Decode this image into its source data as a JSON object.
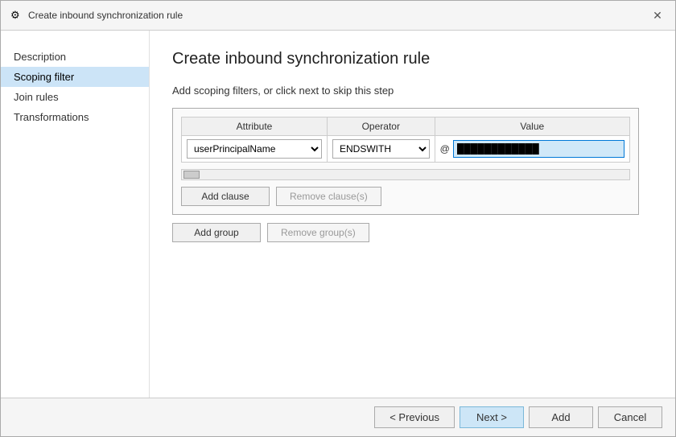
{
  "titleBar": {
    "icon": "⚙",
    "text": "Create inbound synchronization rule",
    "closeLabel": "✕"
  },
  "pageTitle": "Create inbound synchronization rule",
  "sectionDesc": "Add scoping filters, or click next to skip this step",
  "sidebar": {
    "items": [
      {
        "id": "description",
        "label": "Description",
        "active": false
      },
      {
        "id": "scoping-filter",
        "label": "Scoping filter",
        "active": true
      },
      {
        "id": "join-rules",
        "label": "Join rules",
        "active": false
      },
      {
        "id": "transformations",
        "label": "Transformations",
        "active": false
      }
    ]
  },
  "filterTable": {
    "columns": [
      {
        "id": "attribute",
        "label": "Attribute"
      },
      {
        "id": "operator",
        "label": "Operator"
      },
      {
        "id": "value",
        "label": "Value"
      }
    ],
    "rows": [
      {
        "attribute": "userPrincipalName",
        "operator": "ENDSWITH",
        "valuePrefix": "@",
        "value": "████████████"
      }
    ]
  },
  "buttons": {
    "addClause": "Add clause",
    "removeClause": "Remove clause(s)",
    "addGroup": "Add group",
    "removeGroup": "Remove group(s)"
  },
  "footer": {
    "previous": "< Previous",
    "next": "Next >",
    "add": "Add",
    "cancel": "Cancel"
  }
}
